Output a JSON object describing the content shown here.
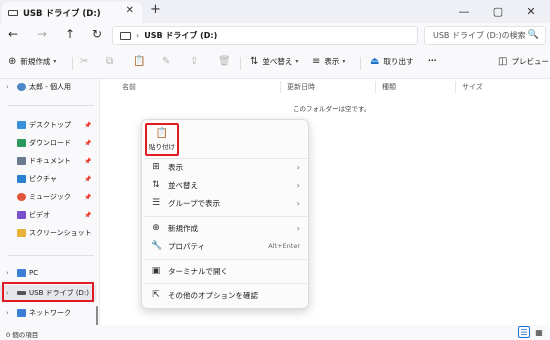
{
  "window": {
    "tab_title": "USB ドライブ (D:)",
    "tab_close": "✕",
    "new_tab": "+",
    "minimize": "—",
    "maximize": "▢",
    "close": "✕"
  },
  "addressbar": {
    "back": "←",
    "forward": "→",
    "up": "↑",
    "refresh": "↻",
    "separator": "›",
    "path": "USB ドライブ (D:)",
    "search_placeholder": "USB ドライブ (D:)の検索",
    "search_icon": "🔍"
  },
  "commandbar": {
    "new_label": "新規作成",
    "sort_label": "並べ替え",
    "view_label": "表示",
    "eject_label": "取り出す",
    "more_label": "···",
    "preview_label": "プレビュー",
    "new_icon": "⊕",
    "cut_icon": "✂",
    "copy_icon": "⧉",
    "paste_icon": "📋",
    "rename_icon": "✎",
    "share_icon": "⇪",
    "delete_icon": "🗑",
    "sort_icon": "⇅",
    "view_icon": "≡",
    "eject_icon": "⏏",
    "preview_icon": "◫",
    "chevron": "▾"
  },
  "sidebar": {
    "items": [
      {
        "label": "太郎 - 個人用",
        "expand": "›",
        "color": "#4a86c8"
      },
      {
        "label": "デスクトップ",
        "pin": "📌",
        "color": "#3b8ed8"
      },
      {
        "label": "ダウンロード",
        "pin": "📌",
        "color": "#2b9a5c"
      },
      {
        "label": "ドキュメント",
        "pin": "📌",
        "color": "#6b7a8f"
      },
      {
        "label": "ピクチャ",
        "pin": "📌",
        "color": "#2d7fd1"
      },
      {
        "label": "ミュージック",
        "pin": "📌",
        "color": "#e2553a"
      },
      {
        "label": "ビデオ",
        "pin": "📌",
        "color": "#7b4fc9"
      },
      {
        "label": "スクリーンショット",
        "color": "#e8b23a"
      },
      {
        "label": "PC",
        "expand": "›",
        "color": "#3b7fd4"
      },
      {
        "label": "USB ドライブ (D:)",
        "expand": "›",
        "color": "#555555"
      },
      {
        "label": "ネットワーク",
        "expand": "›",
        "color": "#3b7fd4"
      }
    ]
  },
  "content": {
    "columns": [
      "名前",
      "更新日時",
      "種類",
      "サイズ"
    ],
    "empty_message": "このフォルダーは空です。"
  },
  "context_menu": {
    "paste_label": "貼り付け",
    "paste_icon": "📋",
    "items": [
      {
        "label": "表示",
        "icon": "⊞",
        "arrow": "›"
      },
      {
        "label": "並べ替え",
        "icon": "⇅",
        "arrow": "›"
      },
      {
        "label": "グループで表示",
        "icon": "☰",
        "arrow": "›"
      },
      {
        "label": "新規作成",
        "icon": "⊕",
        "arrow": "›"
      },
      {
        "label": "プロパティ",
        "icon": "🔧",
        "shortcut": "Alt+Enter"
      },
      {
        "label": "ターミナルで開く",
        "icon": "▣"
      },
      {
        "label": "その他のオプションを確認",
        "icon": "⇱"
      }
    ]
  },
  "statusbar": {
    "item_count": "0 個の項目",
    "details_icon": "☰",
    "tiles_icon": "▦"
  },
  "colors": {
    "highlight_red": "#e01b24",
    "accent_blue": "#1a73c9"
  }
}
